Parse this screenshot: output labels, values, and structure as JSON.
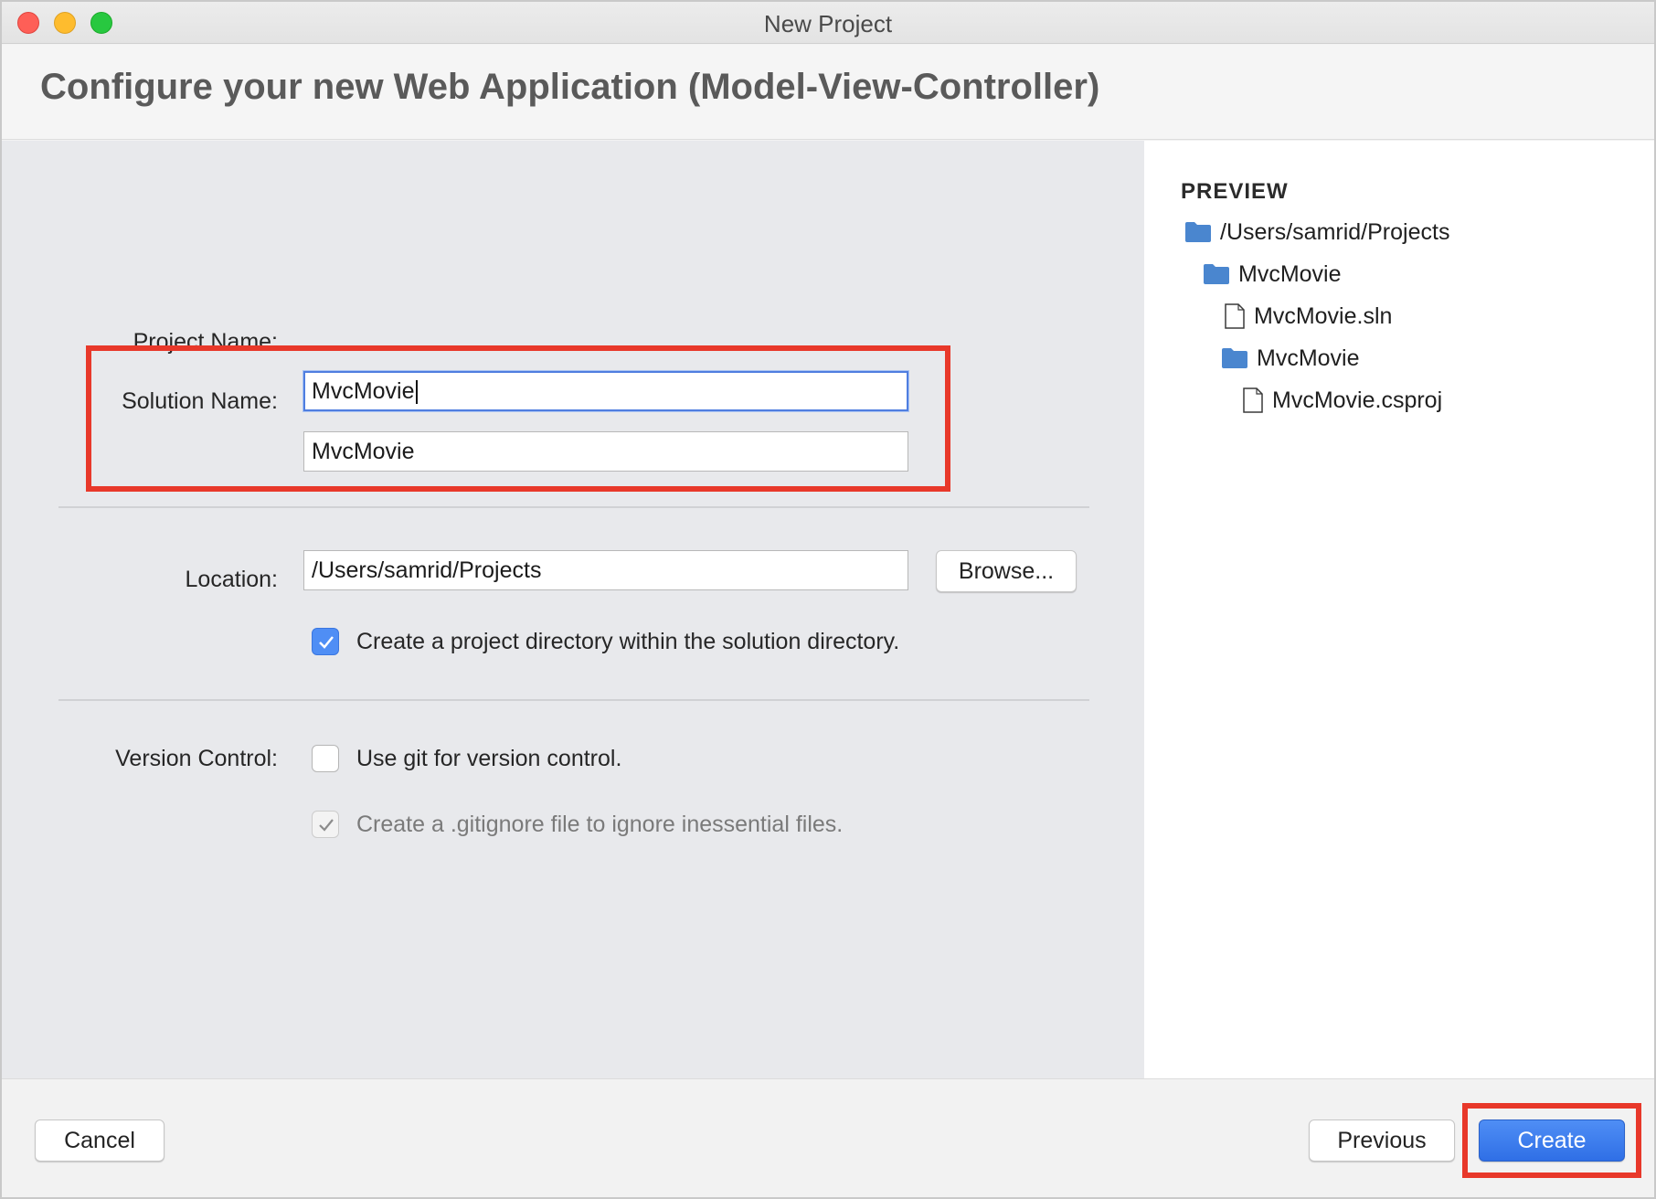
{
  "window": {
    "title": "New Project"
  },
  "header": {
    "title": "Configure your new Web Application (Model-View-Controller)"
  },
  "form": {
    "project_name_label": "Project Name:",
    "project_name_value": "MvcMovie",
    "solution_name_label": "Solution Name:",
    "solution_name_value": "MvcMovie",
    "location_label": "Location:",
    "location_value": "/Users/samrid/Projects",
    "browse_label": "Browse...",
    "create_dir_label": "Create a project directory within the solution directory.",
    "create_dir_checked": true,
    "version_control_label": "Version Control:",
    "use_git_label": "Use git for version control.",
    "use_git_checked": false,
    "gitignore_label": "Create a .gitignore file to ignore inessential files.",
    "gitignore_checked": true,
    "gitignore_enabled": false
  },
  "preview": {
    "title": "PREVIEW",
    "items": [
      {
        "type": "folder",
        "name": "/Users/samrid/Projects"
      },
      {
        "type": "folder",
        "name": "MvcMovie"
      },
      {
        "type": "file",
        "name": "MvcMovie.sln"
      },
      {
        "type": "folder",
        "name": "MvcMovie"
      },
      {
        "type": "file",
        "name": "MvcMovie.csproj"
      }
    ]
  },
  "footer": {
    "cancel_label": "Cancel",
    "previous_label": "Previous",
    "create_label": "Create"
  },
  "colors": {
    "accent": "#3b7de9",
    "highlight": "#e8382a",
    "folder": "#4a86cf"
  }
}
